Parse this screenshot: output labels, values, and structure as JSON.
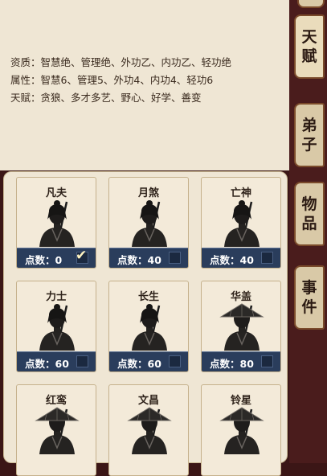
{
  "info": {
    "aptitude": "资质：智慧绝、管理绝、外功乙、内功乙、轻功绝",
    "attributes": "属性：智慧6、管理5、外功4、内功4、轻功6",
    "talents": "天赋：贪狼、多才多艺、野心、好学、善变"
  },
  "tabs": [
    {
      "label": "天赋",
      "name": "tab-talent"
    },
    {
      "label": "弟子",
      "name": "tab-disciple"
    },
    {
      "label": "物品",
      "name": "tab-items"
    },
    {
      "label": "事件",
      "name": "tab-events"
    }
  ],
  "cards": [
    {
      "name": "凡夫",
      "points": "点数：0",
      "checked": true,
      "hat": false
    },
    {
      "name": "月煞",
      "points": "点数：40",
      "checked": false,
      "hat": false
    },
    {
      "name": "亡神",
      "points": "点数：40",
      "checked": false,
      "hat": false
    },
    {
      "name": "力士",
      "points": "点数：60",
      "checked": false,
      "hat": false
    },
    {
      "name": "长生",
      "points": "点数：60",
      "checked": false,
      "hat": false
    },
    {
      "name": "华盖",
      "points": "点数：80",
      "checked": false,
      "hat": true
    },
    {
      "name": "红鸾",
      "points": "",
      "checked": false,
      "hat": true
    },
    {
      "name": "文昌",
      "points": "",
      "checked": false,
      "hat": true
    },
    {
      "name": "铃星",
      "points": "",
      "checked": false,
      "hat": true
    }
  ],
  "check_mark": "✔",
  "colors": {
    "bar": "#2a3d5c",
    "parchment": "#efe6d4",
    "side": "#4a1c1c"
  }
}
